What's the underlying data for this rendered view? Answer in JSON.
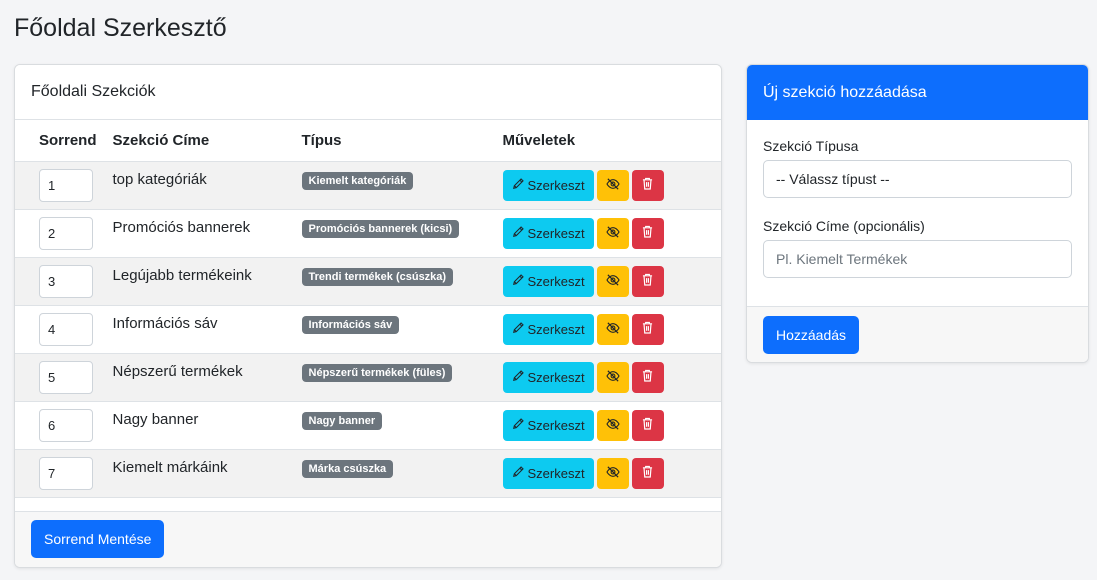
{
  "page": {
    "title": "Főoldal Szerkesztő"
  },
  "sections_card": {
    "header": "Főoldali Szekciók",
    "columns": {
      "order": "Sorrend",
      "title": "Szekció Címe",
      "type": "Típus",
      "actions": "Műveletek"
    },
    "edit_label": "Szerkeszt",
    "rows": [
      {
        "order": "1",
        "title": "top kategóriák",
        "type": "Kiemelt kategóriák"
      },
      {
        "order": "2",
        "title": "Promóciós bannerek",
        "type": "Promóciós bannerek (kicsi)"
      },
      {
        "order": "3",
        "title": "Legújabb termékeink",
        "type": "Trendi termékek (csúszka)"
      },
      {
        "order": "4",
        "title": "Információs sáv",
        "type": "Információs sáv"
      },
      {
        "order": "5",
        "title": "Népszerű termékek",
        "type": "Népszerű termékek (füles)"
      },
      {
        "order": "6",
        "title": "Nagy banner",
        "type": "Nagy banner"
      },
      {
        "order": "7",
        "title": "Kiemelt márkáink",
        "type": "Márka csúszka"
      }
    ],
    "save_order_label": "Sorrend Mentése"
  },
  "add_card": {
    "header": "Új szekció hozzáadása",
    "type_label": "Szekció Típusa",
    "type_value": "-- Válassz típust --",
    "title_label": "Szekció Címe (opcionális)",
    "title_placeholder": "Pl. Kiemelt Termékek",
    "submit_label": "Hozzáadás"
  },
  "colors": {
    "primary": "#0d6efd",
    "info": "#0dcaf0",
    "warning": "#ffc107",
    "danger": "#dc3545",
    "badge": "#6c757d"
  },
  "icons": {
    "edit": "pencil-icon",
    "hide": "eye-slash-icon",
    "delete": "trash-icon"
  }
}
